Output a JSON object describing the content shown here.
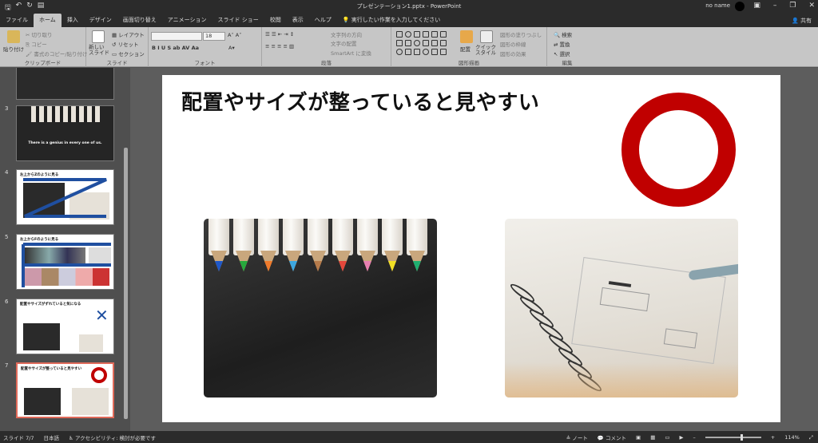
{
  "window": {
    "title": "プレゼンテーション1.pptx - PowerPoint",
    "user": "no name"
  },
  "tabs": [
    "ファイル",
    "ホーム",
    "挿入",
    "デザイン",
    "画面切り替え",
    "アニメーション",
    "スライド ショー",
    "校閲",
    "表示",
    "ヘルプ"
  ],
  "tell_me": "実行したい作業を入力してください",
  "share": "共有",
  "ribbon": {
    "clipboard": {
      "label": "クリップボード",
      "paste": "貼り付け",
      "cut": "切り取り",
      "copy": "コピー",
      "format_painter": "書式のコピー/貼り付け"
    },
    "slides": {
      "label": "スライド",
      "new_slide": "新しい スライド",
      "layout": "レイアウト",
      "reset": "リセット",
      "section": "セクション"
    },
    "font": {
      "label": "フォント",
      "font_size": "18"
    },
    "paragraph": {
      "label": "段落",
      "text_direction": "文字列の方向",
      "align_text": "文字の配置",
      "smartart": "SmartArt に変換"
    },
    "drawing": {
      "label": "図形描画",
      "arrange": "配置",
      "quick_styles": "クイック スタイル",
      "fill": "図形の塗りつぶし",
      "outline": "図形の枠線",
      "effects": "図形の効果"
    },
    "editing": {
      "label": "編集",
      "find": "検索",
      "replace": "置換",
      "select": "選択"
    }
  },
  "thumbnails": [
    {
      "num": "",
      "title": ""
    },
    {
      "num": "3",
      "title": "There is a genius in every one of us."
    },
    {
      "num": "4",
      "title": "左上からZのように見る"
    },
    {
      "num": "5",
      "title": "左上からFのように見る"
    },
    {
      "num": "6",
      "title": "配置やサイズがずれていると気になる"
    },
    {
      "num": "7",
      "title": "配置やサイズが整っていると見やすい"
    }
  ],
  "slide": {
    "title": "配置やサイズが整っていると見やすい",
    "ring_color": "#c00000"
  },
  "status": {
    "slide_pos": "スライド 7/7",
    "language": "日本語",
    "accessibility": "アクセシビリティ: 検討が必要です",
    "notes": "ノート",
    "comments": "コメント",
    "zoom": "114%"
  }
}
